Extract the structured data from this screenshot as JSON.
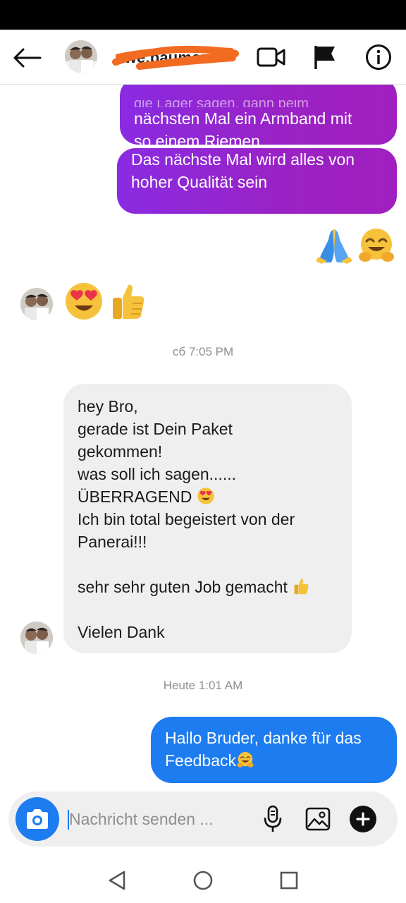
{
  "header": {
    "username": "uwe.baumer",
    "icons": {
      "back": "arrow-left-icon",
      "video": "video-call-icon",
      "flag": "flag-icon",
      "info": "info-icon"
    }
  },
  "messages": {
    "out_1_partial_top": "die Lager sagen, dann beim",
    "out_1": "nächsten Mal ein Armband mit\nso einem Riemen",
    "out_2": "Das nächste Mal wird alles von\nhoher Qualität sein",
    "out_emojis": [
      "folded-hands-emoji",
      "hugging-face-emoji"
    ],
    "in_emojis": [
      "heart-eyes-emoji",
      "thumbs-up-emoji"
    ],
    "timestamp_1": "сб 7:05 PM",
    "in_long": {
      "part_1": "hey Bro,\ngerade ist Dein Paket\ngekommen!\nwas soll ich sagen......\nÜBERRAGEND ",
      "part_2": "\nIch bin total begeistert von der\nPanerai!!!\n\nsehr sehr guten Job gemacht ",
      "part_3": "\n\nVielen Dank"
    },
    "timestamp_2": "Heute 1:01 AM",
    "out_3": "Hallo Bruder, danke für das\nFeedback"
  },
  "composer": {
    "placeholder": "Nachricht senden ...",
    "icons": {
      "camera": "camera-icon",
      "mic": "microphone-icon",
      "image": "image-icon",
      "plus": "plus-icon"
    }
  },
  "colors": {
    "outgoing_purple": "#9a22c4",
    "outgoing_blue": "#1c7cf0",
    "incoming_bg": "#efefef",
    "scribble": "#f26b21"
  }
}
